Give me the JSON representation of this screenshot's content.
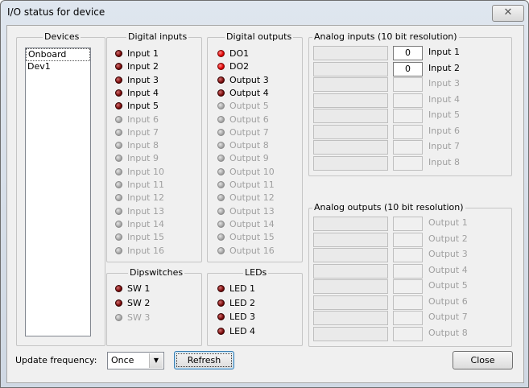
{
  "window": {
    "title": "I/O status for device",
    "close_glyph": "✕"
  },
  "devices": {
    "title": "Devices",
    "items": [
      "Onboard",
      "Dev1"
    ],
    "selected": 0
  },
  "digital_inputs": {
    "title": "Digital inputs",
    "items": [
      {
        "label": "Input 1",
        "state": "dark"
      },
      {
        "label": "Input 2",
        "state": "dark"
      },
      {
        "label": "Input 3",
        "state": "dark"
      },
      {
        "label": "Input 4",
        "state": "dark"
      },
      {
        "label": "Input 5",
        "state": "dark"
      },
      {
        "label": "Input 6",
        "state": "gray"
      },
      {
        "label": "Input 7",
        "state": "gray"
      },
      {
        "label": "Input 8",
        "state": "gray"
      },
      {
        "label": "Input 9",
        "state": "gray"
      },
      {
        "label": "Input 10",
        "state": "gray"
      },
      {
        "label": "Input 11",
        "state": "gray"
      },
      {
        "label": "Input 12",
        "state": "gray"
      },
      {
        "label": "Input 13",
        "state": "gray"
      },
      {
        "label": "Input 14",
        "state": "gray"
      },
      {
        "label": "Input 15",
        "state": "gray"
      },
      {
        "label": "Input 16",
        "state": "gray"
      }
    ]
  },
  "digital_outputs": {
    "title": "Digital outputs",
    "items": [
      {
        "label": "DO1",
        "state": "on"
      },
      {
        "label": "DO2",
        "state": "on"
      },
      {
        "label": "Output 3",
        "state": "dark"
      },
      {
        "label": "Output 4",
        "state": "dark"
      },
      {
        "label": "Output 5",
        "state": "gray"
      },
      {
        "label": "Output 6",
        "state": "gray"
      },
      {
        "label": "Output 7",
        "state": "gray"
      },
      {
        "label": "Output 8",
        "state": "gray"
      },
      {
        "label": "Output 9",
        "state": "gray"
      },
      {
        "label": "Output 10",
        "state": "gray"
      },
      {
        "label": "Output 11",
        "state": "gray"
      },
      {
        "label": "Output 12",
        "state": "gray"
      },
      {
        "label": "Output 13",
        "state": "gray"
      },
      {
        "label": "Output 14",
        "state": "gray"
      },
      {
        "label": "Output 15",
        "state": "gray"
      },
      {
        "label": "Output 16",
        "state": "gray"
      }
    ]
  },
  "dipswitches": {
    "title": "Dipswitches",
    "items": [
      {
        "label": "SW 1",
        "state": "dark"
      },
      {
        "label": "SW 2",
        "state": "dark"
      },
      {
        "label": "SW 3",
        "state": "gray"
      }
    ]
  },
  "leds": {
    "title": "LEDs",
    "items": [
      {
        "label": "LED 1",
        "state": "dark"
      },
      {
        "label": "LED 2",
        "state": "dark"
      },
      {
        "label": "LED 3",
        "state": "dark"
      },
      {
        "label": "LED 4",
        "state": "dark"
      }
    ]
  },
  "analog_inputs": {
    "title": "Analog inputs (10 bit resolution)",
    "items": [
      {
        "label": "Input 1",
        "value": "0",
        "enabled": true
      },
      {
        "label": "Input 2",
        "value": "0",
        "enabled": true
      },
      {
        "label": "Input 3",
        "value": "",
        "enabled": false
      },
      {
        "label": "Input 4",
        "value": "",
        "enabled": false
      },
      {
        "label": "Input 5",
        "value": "",
        "enabled": false
      },
      {
        "label": "Input 6",
        "value": "",
        "enabled": false
      },
      {
        "label": "Input 7",
        "value": "",
        "enabled": false
      },
      {
        "label": "Input 8",
        "value": "",
        "enabled": false
      }
    ]
  },
  "analog_outputs": {
    "title": "Analog outputs (10 bit resolution)",
    "items": [
      {
        "label": "Output 1",
        "value": "",
        "enabled": false
      },
      {
        "label": "Output 2",
        "value": "",
        "enabled": false
      },
      {
        "label": "Output 3",
        "value": "",
        "enabled": false
      },
      {
        "label": "Output 4",
        "value": "",
        "enabled": false
      },
      {
        "label": "Output 5",
        "value": "",
        "enabled": false
      },
      {
        "label": "Output 6",
        "value": "",
        "enabled": false
      },
      {
        "label": "Output 7",
        "value": "",
        "enabled": false
      },
      {
        "label": "Output 8",
        "value": "",
        "enabled": false
      }
    ]
  },
  "footer": {
    "update_label": "Update frequency:",
    "update_value": "Once",
    "dropdown_glyph": "▼",
    "refresh_label": "Refresh",
    "close_label": "Close"
  }
}
